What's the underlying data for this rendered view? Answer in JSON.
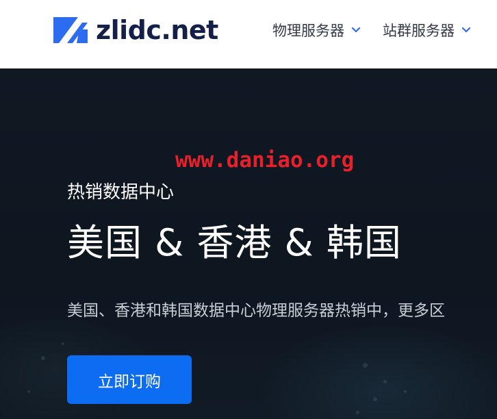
{
  "header": {
    "logo_text": "zlidc.net",
    "nav": [
      {
        "label": "物理服务器"
      },
      {
        "label": "站群服务器"
      }
    ]
  },
  "hero": {
    "watermark": "www.daniao.org",
    "subtitle": "热销数据中心",
    "headline": "美国 & 香港 & 韩国",
    "description": "美国、香港和韩国数据中心物理服务器热销中，更多区",
    "cta_label": "立即订购"
  },
  "colors": {
    "brand_blue": "#2b6cf0",
    "logo_text": "#15204a",
    "cta_blue": "#0c6cf2",
    "hero_bg": "#0f1722",
    "watermark_red": "#e8202a"
  },
  "icons": {
    "logo": "zl-logo-icon",
    "nav_chevron": "chevron-down-icon"
  }
}
